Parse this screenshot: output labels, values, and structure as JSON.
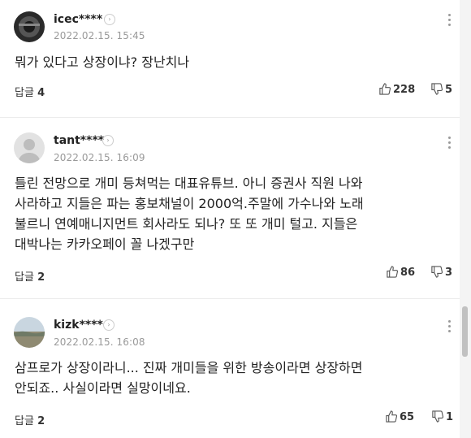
{
  "comments": [
    {
      "nickname": "icec****",
      "date": "2022.02.15. 15:45",
      "text": "뭐가 있다고 상장이냐? 장난치나",
      "reply_label": "답글",
      "reply_count": "4",
      "likes": "228",
      "dislikes": "5",
      "avatar": "dark-photo"
    },
    {
      "nickname": "tant****",
      "date": "2022.02.15. 16:09",
      "text": "틀린 전망으로 개미 등쳐먹는 대표유튜브. 아니 증권사 직원 나와\n사라하고 지들은 파는 홍보채널이 2000억.주말에 가수나와 노래\n불르니 연예매니지먼트 회사라도 되나? 또 또 개미 털고. 지들은\n대박나는 카카오페이 꼴 나겠구만",
      "reply_label": "답글",
      "reply_count": "2",
      "likes": "86",
      "dislikes": "3",
      "avatar": "default-user"
    },
    {
      "nickname": "kizk****",
      "date": "2022.02.15. 16:08",
      "text": "삼프로가 상장이라니... 진짜 개미들을 위한 방송이라면 상장하면\n안되죠.. 사실이라면 실망이네요.",
      "reply_label": "답글",
      "reply_count": "2",
      "likes": "65",
      "dislikes": "1",
      "avatar": "landscape-photo"
    }
  ],
  "icons": {
    "like": "thumbs-up-icon",
    "dislike": "thumbs-down-icon",
    "more": "kebab-menu-icon",
    "profile_link": "chevron-right-icon"
  }
}
